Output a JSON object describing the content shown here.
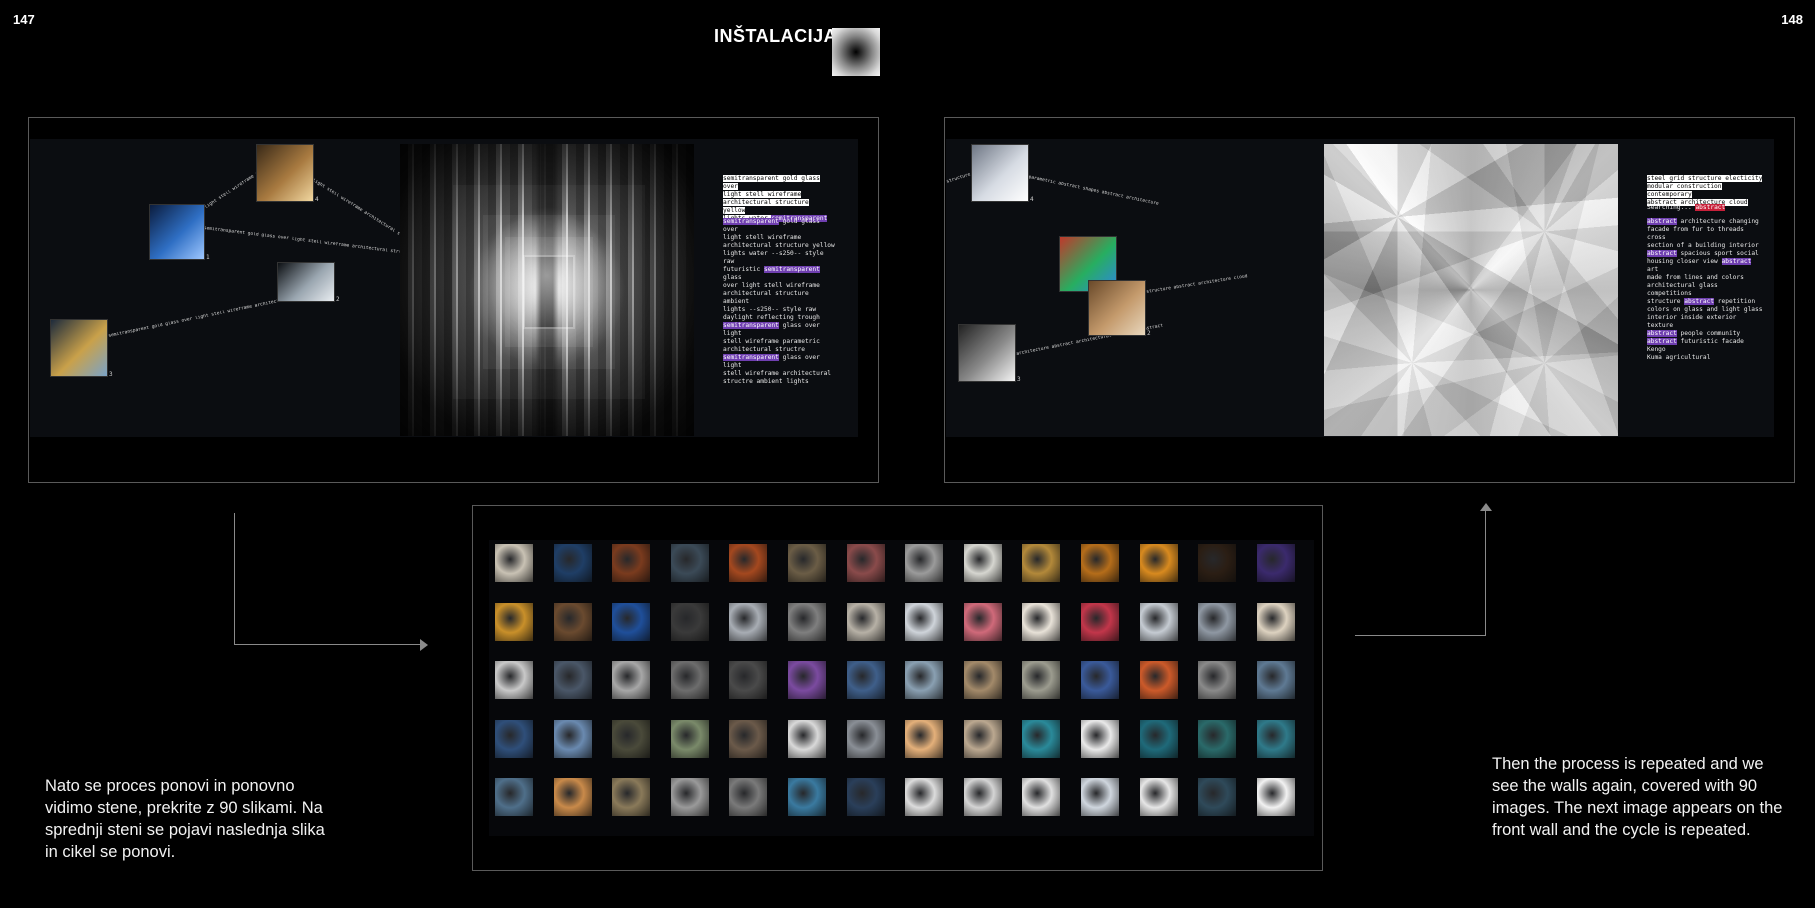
{
  "page": {
    "left_number": "147",
    "right_number": "148",
    "title": "INŠTALACIJA"
  },
  "left_panel": {
    "thumbnails": [
      {
        "label": "4",
        "colors": [
          "#3a2a18",
          "#a87a40",
          "#f1d7a0"
        ]
      },
      {
        "label": "1",
        "colors": [
          "#0b1d3f",
          "#2f6fc4",
          "#9ec7ff"
        ]
      },
      {
        "label": "2",
        "colors": [
          "#0d1014",
          "#9aa6b0",
          "#e9edf1"
        ]
      },
      {
        "label": "3",
        "colors": [
          "#1d2b3c",
          "#c9a14a",
          "#7aa3c8"
        ]
      }
    ],
    "wire_texts": [
      "light stell wireframe architectural structure",
      "semitransparent gold glass over light stell wireframe architectural structure",
      "light stell wireframe architectural structure yellow",
      "semitransparent gold glass over light stell wireframe architectural structure yell"
    ],
    "code_top": [
      {
        "text": "semitransparent gold glass over",
        "hl": "white"
      },
      {
        "text": "light stell wireframe",
        "hl": "white"
      },
      {
        "text": "architectural structure yellow",
        "hl": "white"
      },
      {
        "text": "lights water ",
        "hl": "white"
      },
      {
        "text": "semitransparent",
        "hl": "purple"
      }
    ],
    "code_body": [
      {
        "segments": [
          {
            "text": "semitransparent",
            "hl": "purple"
          },
          {
            "text": " gold glass over",
            "hl": ""
          }
        ]
      },
      {
        "segments": [
          {
            "text": "light stell wireframe",
            "hl": ""
          }
        ]
      },
      {
        "segments": [
          {
            "text": "architectural structure yellow",
            "hl": ""
          }
        ]
      },
      {
        "segments": [
          {
            "text": "lights water --s250-- style raw",
            "hl": ""
          }
        ]
      },
      {
        "segments": [
          {
            "text": "futuristic ",
            "hl": ""
          },
          {
            "text": "semitransparent",
            "hl": "purple"
          },
          {
            "text": " glass",
            "hl": ""
          }
        ]
      },
      {
        "segments": [
          {
            "text": "over light stell wireframe",
            "hl": ""
          }
        ]
      },
      {
        "segments": [
          {
            "text": "architectural structure ambient",
            "hl": ""
          }
        ]
      },
      {
        "segments": [
          {
            "text": "lights --s250-- style raw",
            "hl": ""
          }
        ]
      },
      {
        "segments": [
          {
            "text": "daylight reflecting trough",
            "hl": ""
          }
        ]
      },
      {
        "segments": [
          {
            "text": "semitransparent",
            "hl": "purple"
          },
          {
            "text": " glass over light",
            "hl": ""
          }
        ]
      },
      {
        "segments": [
          {
            "text": "stell wireframe parametric",
            "hl": ""
          }
        ]
      },
      {
        "segments": [
          {
            "text": "architectural structre",
            "hl": ""
          }
        ]
      },
      {
        "segments": [
          {
            "text": "semitransparent",
            "hl": "purple"
          },
          {
            "text": " glass over light",
            "hl": ""
          }
        ]
      },
      {
        "segments": [
          {
            "text": "stell wireframe architectural",
            "hl": ""
          }
        ]
      },
      {
        "segments": [
          {
            "text": "structre ambient lights",
            "hl": ""
          }
        ]
      }
    ]
  },
  "right_panel": {
    "thumbnails": [
      {
        "label": "4",
        "colors": [
          "#6e7684",
          "#d6dbe3",
          "#ffffff"
        ]
      },
      {
        "label": "1",
        "colors": [
          "#c0392b",
          "#27ae60",
          "#2e86de"
        ]
      },
      {
        "label": "2",
        "colors": [
          "#6a4a2a",
          "#c49a6c",
          "#e8d7bd"
        ]
      },
      {
        "label": "3",
        "colors": [
          "#222222",
          "#8a8a8a",
          "#f4f4f4"
        ]
      }
    ],
    "wire_texts": [
      "structure electricity abstract modular construction contemporary abstract",
      "parametric abstract shapes abstract architecture",
      "structure abstract architecture cloud",
      "architecture abstract architectural structure abstract"
    ],
    "code_top": [
      {
        "text": "steel grid structure electicity",
        "hl": "white"
      },
      {
        "text": "modular construction contemporary",
        "hl": "white"
      },
      {
        "text": "abstract architecture cloud",
        "hl": "white"
      }
    ],
    "searching_label": "Searching...",
    "searching_term": "abstract",
    "code_body": [
      {
        "segments": [
          {
            "text": "abstract",
            "hl": "purple"
          },
          {
            "text": " architecture changing",
            "hl": ""
          }
        ]
      },
      {
        "segments": [
          {
            "text": "facade from fur to threads cross",
            "hl": ""
          }
        ]
      },
      {
        "segments": [
          {
            "text": "section of a building interior",
            "hl": ""
          }
        ]
      },
      {
        "segments": [
          {
            "text": "abstract",
            "hl": "purple"
          },
          {
            "text": " spacious sport social",
            "hl": ""
          }
        ]
      },
      {
        "segments": [
          {
            "text": "housing closer view ",
            "hl": ""
          },
          {
            "text": "abstract",
            "hl": "purple"
          },
          {
            "text": " art",
            "hl": ""
          }
        ]
      },
      {
        "segments": [
          {
            "text": "made from lines and colors",
            "hl": ""
          }
        ]
      },
      {
        "segments": [
          {
            "text": "architectural glass competitions",
            "hl": ""
          }
        ]
      },
      {
        "segments": [
          {
            "text": "structure ",
            "hl": ""
          },
          {
            "text": "abstract",
            "hl": "purple"
          },
          {
            "text": " repetition",
            "hl": ""
          }
        ]
      },
      {
        "segments": [
          {
            "text": "colors on glass and light glass",
            "hl": ""
          }
        ]
      },
      {
        "segments": [
          {
            "text": "interior inside exterior texture",
            "hl": ""
          }
        ]
      },
      {
        "segments": [
          {
            "text": "abstract",
            "hl": "purple"
          },
          {
            "text": " people community",
            "hl": ""
          }
        ]
      },
      {
        "segments": [
          {
            "text": "abstract",
            "hl": "purple"
          },
          {
            "text": " futuristic facade Kengo",
            "hl": ""
          }
        ]
      },
      {
        "segments": [
          {
            "text": "Kuma agricultural",
            "hl": ""
          }
        ]
      }
    ]
  },
  "grid": {
    "rows": [
      [
        "#c9c2b4",
        "#1f3e66",
        "#7a3b1e",
        "#3b4a57",
        "#a4481f",
        "#6b5d46",
        "#8a4b4b",
        "#9b9b9b",
        "#d6d6d0",
        "#b3893a",
        "#b56d1a",
        "#d88a1f",
        "#2b1e14",
        "#3b2a6d"
      ],
      [
        "#c9902a",
        "#6a4a2f",
        "#1f4f9a",
        "#3a3a3a",
        "#a8adb4",
        "#7f7f7f",
        "#b7b1a6",
        "#cfd4da",
        "#d06a7a",
        "#e8e2d8",
        "#c2364a",
        "#c5cbd2",
        "#8f98a3",
        "#ddd2c0"
      ],
      [
        "#c9c9c9",
        "#4a5768",
        "#a7a7a7",
        "#6d6d6d",
        "#4a4a4a",
        "#7b4ba0",
        "#3f5f8a",
        "#8aa0b2",
        "#a38a6a",
        "#9c9c8f",
        "#3a5a9a",
        "#cc5a2a",
        "#8a8a8a",
        "#5f7a94"
      ],
      [
        "#2f4f7a",
        "#6a8ab0",
        "#4a4a3a",
        "#7a8a6a",
        "#6b5a4a",
        "#d9d9d9",
        "#8a8f96",
        "#e4b07a",
        "#bba890",
        "#2a8a9a",
        "#e9e9e9",
        "#1f6a7a",
        "#2a6a6a",
        "#2f7a8a"
      ],
      [
        "#4f6f8a",
        "#c98a4a",
        "#8a7a5a",
        "#9a9a9a",
        "#7a7a7a",
        "#3a7aa0",
        "#2a3f5a",
        "#dcdcdc",
        "#d4d4d4",
        "#e0e0e0",
        "#cfd6de",
        "#e6e6e6",
        "#2f4a5a",
        "#f2f2f2"
      ]
    ]
  },
  "captions": {
    "left": "Nato se proces ponovi in ponovno vidimo stene, prekrite z 90 slikami. Na sprednji steni se pojavi naslednja slika in cikel se ponovi.",
    "right": "Then the process is repeated and we see the walls again, covered with 90 images. The next image appears on the front wall and the cycle is repeated."
  }
}
